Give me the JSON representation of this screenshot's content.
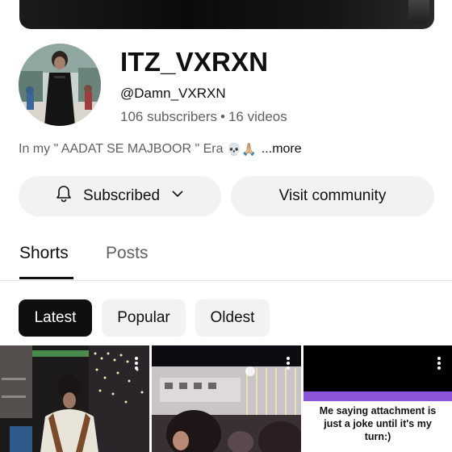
{
  "channel": {
    "name": "ITZ_VXRXN",
    "handle": "@Damn_VXRXN",
    "subscribers": "106 subscribers",
    "separator": "•",
    "videos": "16 videos",
    "description": "In my \" AADAT SE MAJBOOR \" Era",
    "description_emojis": "💀🙏🏼",
    "more_label": "...more"
  },
  "actions": {
    "subscribed_label": "Subscribed",
    "visit_label": "Visit community"
  },
  "tabs": [
    {
      "label": "Shorts",
      "selected": true
    },
    {
      "label": "Posts",
      "selected": false
    }
  ],
  "filters": [
    {
      "label": "Latest",
      "selected": true
    },
    {
      "label": "Popular",
      "selected": false
    },
    {
      "label": "Oldest",
      "selected": false
    }
  ],
  "shorts": [
    {
      "caption": ""
    },
    {
      "caption": ""
    },
    {
      "caption": "Me saying attachment is just a joke until it's my turn:)"
    }
  ],
  "icons": {
    "bell": "bell-icon",
    "chevron": "chevron-down-icon",
    "menu": "more-vert-icon"
  },
  "colors": {
    "chip_selected_bg": "#0f0f0f",
    "chip_bg": "#f2f2f2",
    "secondary_text": "#606060",
    "caption_bar": "#8a55d8"
  }
}
